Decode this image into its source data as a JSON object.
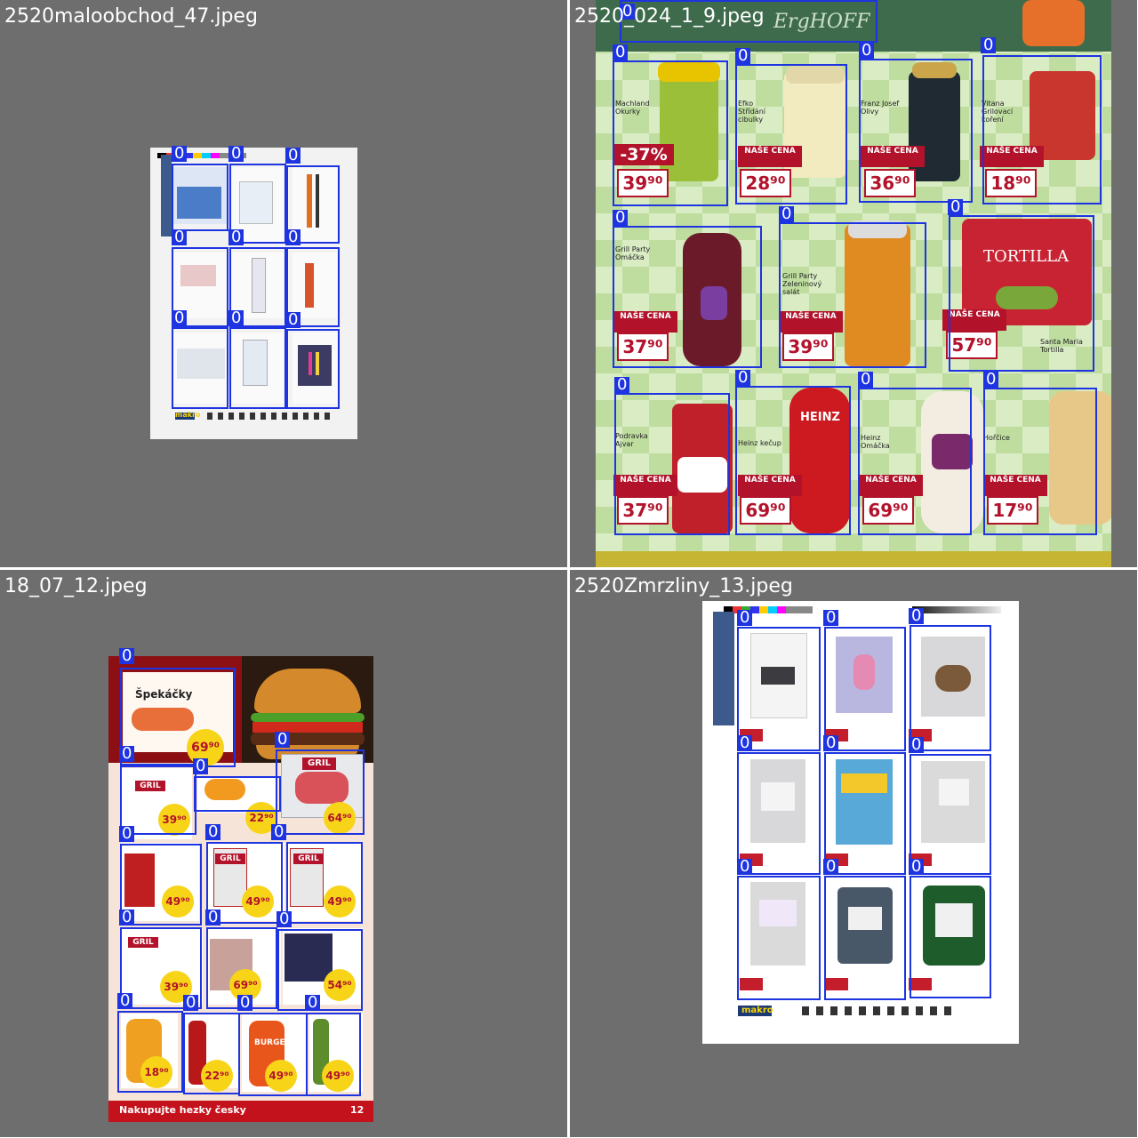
{
  "tiles": [
    {
      "filename": "2520maloobchod_47.jpeg",
      "page_footer_logo": "makro",
      "detections": [
        "0",
        "0",
        "0",
        "0",
        "0",
        "0",
        "0",
        "0",
        "0"
      ]
    },
    {
      "filename": "2520_024_1_9.jpeg",
      "header_text": "ErgHOFF",
      "badge_label": "NAŠE CENA",
      "discount": "-37%",
      "products": [
        {
          "name": "Machland Okurky",
          "price": "39⁹⁰"
        },
        {
          "name": "Efko Střídání cibulky",
          "price": "28⁹⁰"
        },
        {
          "name": "Franz Josef Olivy",
          "price": "36⁹⁰"
        },
        {
          "name": "Vitana Grilovací koření",
          "price": "18⁹⁰"
        },
        {
          "name": "Grill Party Omáčka",
          "price": "37⁹⁰"
        },
        {
          "name": "Grill Party Zeleninový salát",
          "price": "39⁹⁰"
        },
        {
          "name": "Santa Maria Tortilla",
          "price": "57⁹⁰"
        },
        {
          "name": "Podravka Ajvar",
          "price": "37⁹⁰"
        },
        {
          "name": "Heinz kečup",
          "price": "69⁹⁰"
        },
        {
          "name": "Heinz Omáčka",
          "price": "69⁹⁰"
        },
        {
          "name": "Hořčice",
          "price": "17⁹⁰"
        }
      ],
      "tortilla_brand": "TORTILLA",
      "ketchup_brand": "HEINZ",
      "detections": [
        "0",
        "0",
        "0",
        "0",
        "0",
        "0",
        "0",
        "0",
        "0",
        "0",
        "0",
        "0"
      ]
    },
    {
      "filename": "18_07_12.jpeg",
      "footer": "Nakupujte hezky česky",
      "page_no": "12",
      "top_product": "Špekáčky",
      "prices": [
        "69⁹⁰",
        "39⁹⁰",
        "22⁹⁰",
        "64⁹⁰",
        "49⁹⁰",
        "49⁹⁰",
        "49⁹⁰",
        "39⁹⁰",
        "69⁹⁰",
        "54⁹⁰",
        "18⁹⁰",
        "22⁹⁰",
        "49⁹⁰",
        "49⁹⁰"
      ],
      "grill_label": "GRIL",
      "burger_label": "BURGER",
      "detections": [
        "0",
        "0",
        "0",
        "0",
        "0",
        "0",
        "0",
        "0",
        "0",
        "0",
        "0",
        "0",
        "0",
        "0",
        "0",
        "0"
      ]
    },
    {
      "filename": "2520Zmrzliny_13.jpeg",
      "page_footer_logo": "makro",
      "detections": [
        "0",
        "0",
        "0",
        "0",
        "0",
        "0",
        "0",
        "0",
        "0"
      ]
    }
  ],
  "colors": {
    "box": "#1d34e0",
    "tile_bg": "#6e6e6e",
    "price_red": "#b3122b"
  }
}
